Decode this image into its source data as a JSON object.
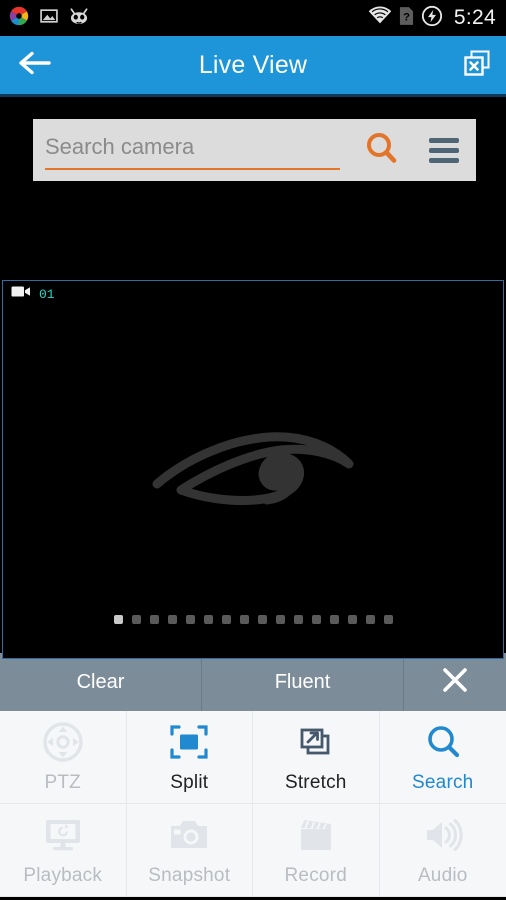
{
  "statusbar": {
    "time": "5:24",
    "left_icons": [
      {
        "name": "app-shutter-icon",
        "label": "shutter"
      },
      {
        "name": "gallery-image-icon",
        "label": "image"
      },
      {
        "name": "cyanogenmod-icon",
        "label": "cyanogenmod"
      }
    ],
    "right_icons": [
      {
        "name": "wifi-icon",
        "label": "wifi"
      },
      {
        "name": "sim-unknown-icon",
        "label": "sim-card-question"
      },
      {
        "name": "battery-charging-icon",
        "label": "charging"
      }
    ]
  },
  "appbar": {
    "title": "Live View",
    "back_icon": "back-arrow-icon",
    "close_all_icon": "close-window-icon",
    "bg_color": "#1e94d9"
  },
  "search": {
    "placeholder": "Search camera",
    "value": "",
    "search_icon": "search-icon",
    "menu_icon": "hamburger-menu-icon",
    "accent_color": "#e2752a",
    "bg_color": "#dcdcdc"
  },
  "video": {
    "channel_label": "01",
    "channel_icon": "video-camera-icon",
    "label_color": "#23d7c4",
    "border_color": "#2f6da3",
    "watermark_icon": "eye-spiral-logo",
    "watermark_color": "#333333",
    "pages": {
      "total": 16,
      "active": 1
    }
  },
  "quality_bar": {
    "items": [
      {
        "label": "Clear",
        "name": "quality-clear-button"
      },
      {
        "label": "Fluent",
        "name": "quality-fluent-button"
      }
    ],
    "close_icon": "close-icon",
    "bg_color": "#7d8c99"
  },
  "tools": [
    {
      "label": "PTZ",
      "name": "tool-ptz",
      "icon": "ptz-joystick-icon",
      "state": "disabled"
    },
    {
      "label": "Split",
      "name": "tool-split",
      "icon": "split-screen-icon",
      "state": "active"
    },
    {
      "label": "Stretch",
      "name": "tool-stretch",
      "icon": "stretch-icon",
      "state": "enabled"
    },
    {
      "label": "Search",
      "name": "tool-search",
      "icon": "search-icon",
      "state": "accent"
    },
    {
      "label": "Playback",
      "name": "tool-playback",
      "icon": "playback-icon",
      "state": "disabled"
    },
    {
      "label": "Snapshot",
      "name": "tool-snapshot",
      "icon": "camera-icon",
      "state": "disabled"
    },
    {
      "label": "Record",
      "name": "tool-record",
      "icon": "clapperboard-icon",
      "state": "disabled"
    },
    {
      "label": "Audio",
      "name": "tool-audio",
      "icon": "speaker-icon",
      "state": "disabled"
    }
  ],
  "colors": {
    "accent_blue": "#2189cf",
    "appbar_blue": "#1e94d9",
    "orange": "#e2752a",
    "disabled_gray": "#dfe3e7",
    "slate": "#7d8c99"
  }
}
